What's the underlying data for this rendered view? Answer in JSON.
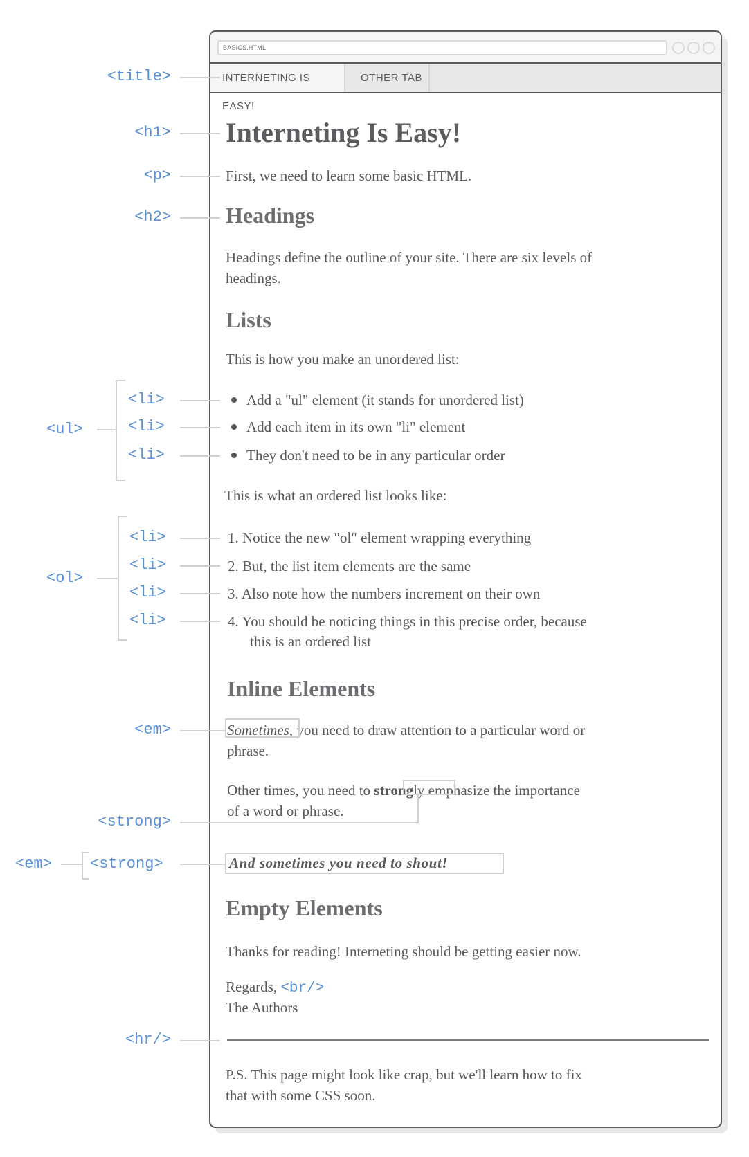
{
  "browser": {
    "url": "BASICS.HTML",
    "tabs": [
      {
        "label": "INTERNETING IS EASY!",
        "active": true
      },
      {
        "label": "OTHER TAB",
        "active": false
      }
    ]
  },
  "annotations": {
    "title": "<title>",
    "h1": "<h1>",
    "p": "<p>",
    "h2": "<h2>",
    "ul": "<ul>",
    "ul_li": [
      "<li>",
      "<li>",
      "<li>"
    ],
    "ol": "<ol>",
    "ol_li": [
      "<li>",
      "<li>",
      "<li>",
      "<li>"
    ],
    "em": "<em>",
    "strong": "<strong>",
    "em_outer": "<em>",
    "strong_inner": "<strong>",
    "hr": "<hr/>",
    "br": "<br/>"
  },
  "page": {
    "h1": "Interneting Is Easy!",
    "intro": "First, we need to learn some basic HTML.",
    "headings": {
      "title": "Headings",
      "text_line1": "Headings define the outline of your site. There are six levels of",
      "text_line2": "headings."
    },
    "lists": {
      "title": "Lists",
      "ul_intro": "This is how you make an unordered list:",
      "ul_items": [
        "Add a \"ul\" element (it stands for unordered list)",
        "Add each item in its own \"li\" element",
        "They don't need to be in any particular order"
      ],
      "ol_intro": "This is what an ordered list looks like:",
      "ol_items": [
        "1. Notice the new \"ol\" element wrapping everything",
        "2. But, the list item elements are the same",
        "3. Also note how the numbers increment on their own",
        "4. You should be noticing things in this precise order, because"
      ],
      "ol_item4_cont": "this is an ordered list"
    },
    "inline": {
      "title": "Inline Elements",
      "em_word": "Sometimes",
      "em_rest_line1": ", you need to draw attention to a particular word or",
      "em_line2": "phrase.",
      "strong_pre": "Other times, you need to ",
      "strong_word": "strong",
      "strong_post": "ly emphasize the importance",
      "strong_line2": "of a word or phrase.",
      "shout": "And sometimes you need to shout!"
    },
    "empty": {
      "title": "Empty Elements",
      "thanks": "Thanks for reading! Interneting should be getting easier now.",
      "regards": "Regards,",
      "authors": "The Authors",
      "ps_line1": "P.S. This page might look like crap, but we'll learn how to fix",
      "ps_line2": "that with some CSS soon."
    }
  },
  "colors": {
    "annotation_blue": "#5a91d6",
    "text": "#58595b",
    "heading2": "#6d6e71",
    "connector": "#cfd0d1",
    "window_border": "#58595b"
  }
}
